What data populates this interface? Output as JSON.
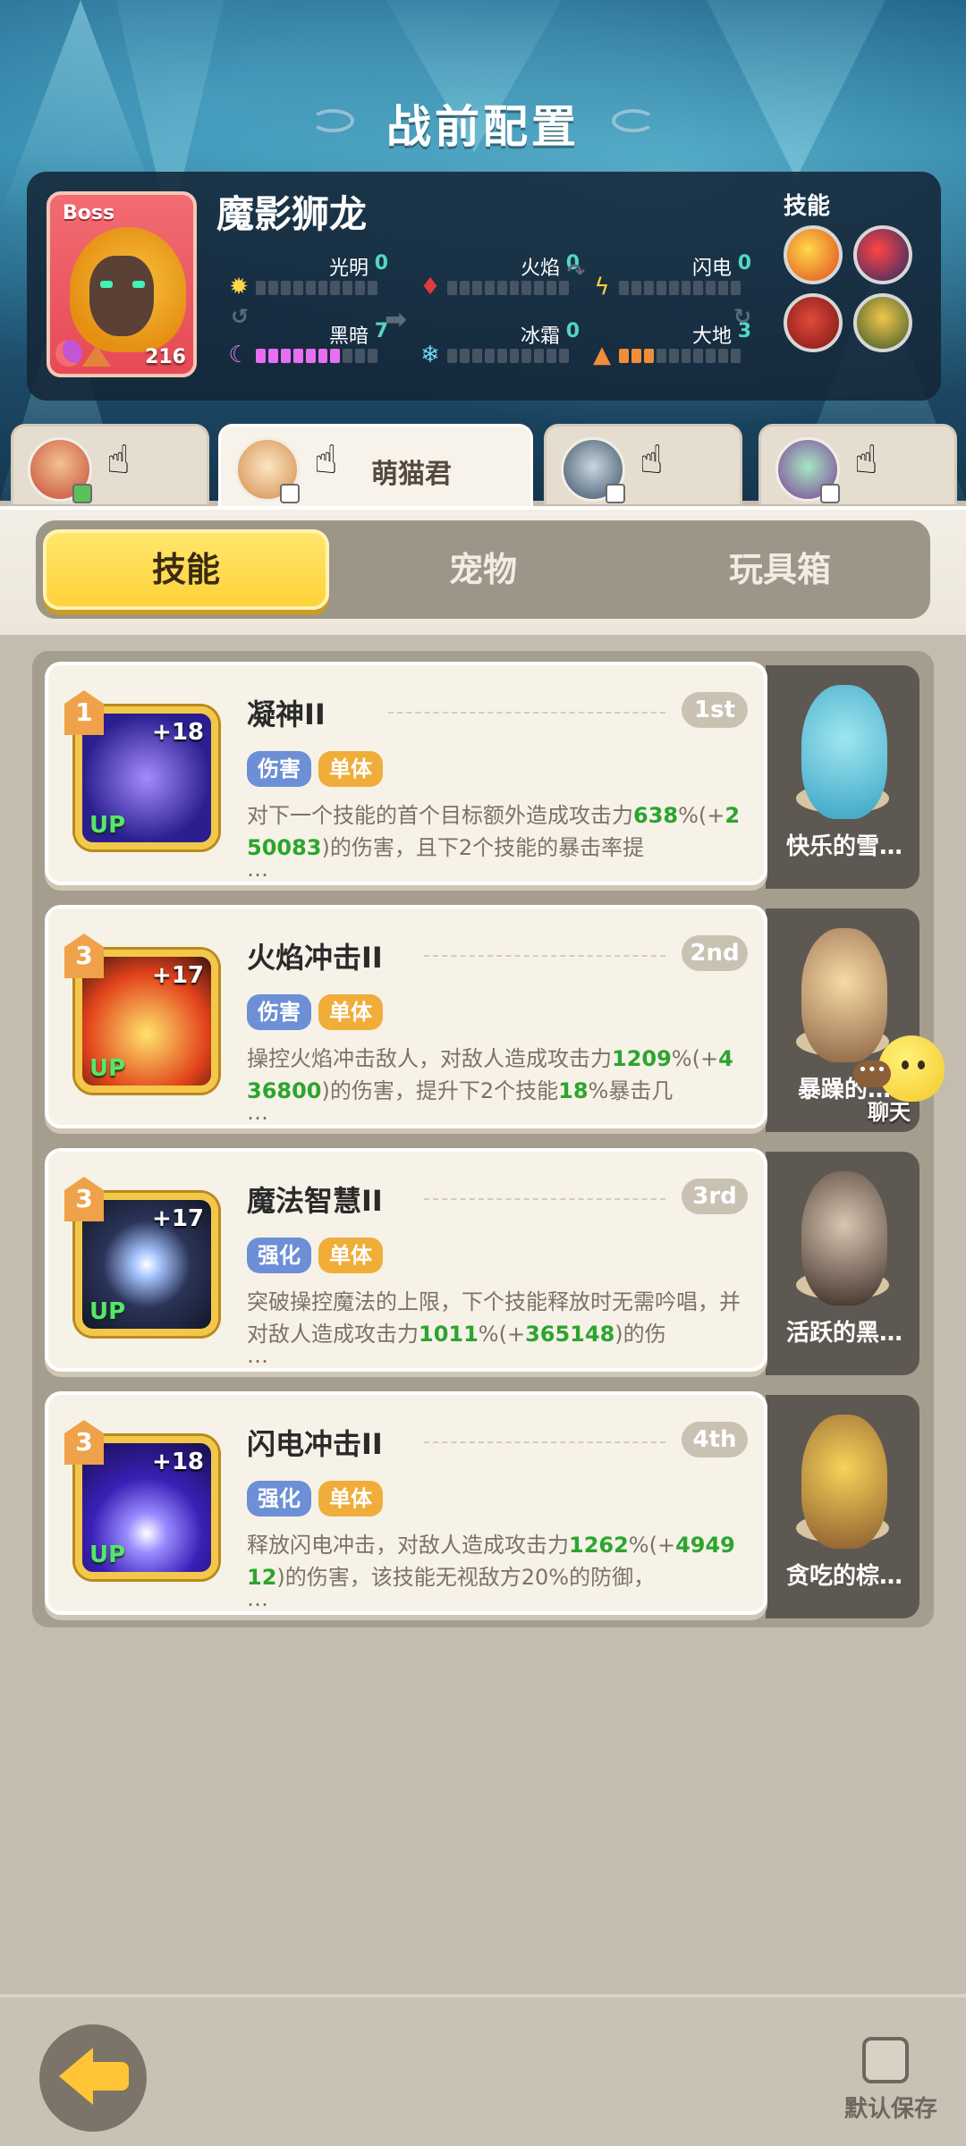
{
  "screen_title": "战前配置",
  "boss": {
    "tag": "Boss",
    "name": "魔影狮龙",
    "level": "216",
    "skills_label": "技能",
    "elements": [
      {
        "label": "光明",
        "value": "0"
      },
      {
        "label": "火焰",
        "value": "0"
      },
      {
        "label": "闪电",
        "value": "0"
      },
      {
        "label": "黑暗",
        "value": "7"
      },
      {
        "label": "冰霜",
        "value": "0"
      },
      {
        "label": "大地",
        "value": "3"
      }
    ]
  },
  "heroes": [
    {
      "name": ""
    },
    {
      "name": "萌猫君"
    },
    {
      "name": ""
    },
    {
      "name": ""
    }
  ],
  "category_tabs": [
    "技能",
    "宠物",
    "玩具箱"
  ],
  "skills": [
    {
      "rank_badge": "1",
      "plus": "+18",
      "up": "UP",
      "title": "凝神II",
      "order": "1st",
      "tags": [
        "伤害",
        "单体"
      ],
      "desc_1": "对下一个技能的首个目标额外造成攻击力",
      "desc_2": "638",
      "desc_3": "%(+",
      "desc_4": "250083",
      "desc_5": ")的伤害，且下2个技能的暴击率提",
      "ellipsis": "…"
    },
    {
      "rank_badge": "3",
      "plus": "+17",
      "up": "UP",
      "title": "火焰冲击II",
      "order": "2nd",
      "tags": [
        "伤害",
        "单体"
      ],
      "desc_1": "操控火焰冲击敌人，对敌人造成攻击力",
      "desc_2": "1209",
      "desc_3": "%(+",
      "desc_4": "436800",
      "desc_5": ")的伤害，提升下2个技能",
      "desc_6": "18",
      "desc_7": "%暴击几",
      "ellipsis": "…"
    },
    {
      "rank_badge": "3",
      "plus": "+17",
      "up": "UP",
      "title": "魔法智慧II",
      "order": "3rd",
      "tags": [
        "强化",
        "单体"
      ],
      "desc_1": "突破操控魔法的上限，下个技能释放时无需吟唱，并对敌人造成攻击力",
      "desc_2": "1011",
      "desc_3": "%(+",
      "desc_4": "365148",
      "desc_5": ")的伤",
      "ellipsis": "…"
    },
    {
      "rank_badge": "3",
      "plus": "+18",
      "up": "UP",
      "title": "闪电冲击II",
      "order": "4th",
      "tags": [
        "强化",
        "单体"
      ],
      "desc_1": "释放闪电冲击，对敌人造成攻击力",
      "desc_2": "1262",
      "desc_3": "%(+",
      "desc_4": "494912",
      "desc_5": ")的伤害，该技能无视敌方20%的防御，",
      "ellipsis": "…"
    }
  ],
  "pets": [
    {
      "name": "快乐的雪…"
    },
    {
      "name": "暴躁的…"
    },
    {
      "name": "活跃的黑…"
    },
    {
      "name": "贪吃的棕…"
    }
  ],
  "chat": {
    "label": "聊天",
    "dots": "•••"
  },
  "default_save": "默认保存",
  "colors": {
    "accent_yellow": "#ffd23a",
    "highlight_green": "#2ba52e",
    "tag_blue": "#6d8fd6",
    "tag_orange": "#f0ad3a"
  }
}
